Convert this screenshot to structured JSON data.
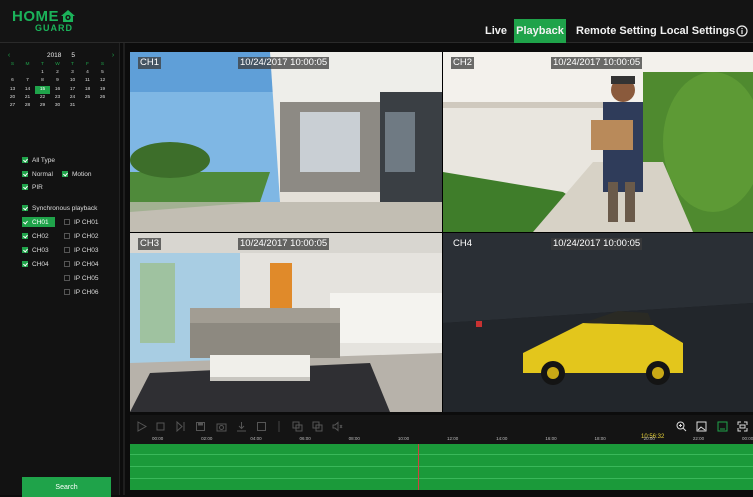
{
  "brand": {
    "line1": "HOME",
    "line2": "GUARD"
  },
  "nav": {
    "live": "Live",
    "playback": "Playback",
    "remote": "Remote Setting",
    "local": "Local Settings"
  },
  "calendar": {
    "year": "2018",
    "month": "5",
    "dow": [
      "S",
      "M",
      "T",
      "W",
      "T",
      "F",
      "S"
    ],
    "weeks": [
      [
        "",
        "",
        "1",
        "2",
        "3",
        "4",
        "5"
      ],
      [
        "6",
        "7",
        "8",
        "9",
        "10",
        "11",
        "12"
      ],
      [
        "13",
        "14",
        "15",
        "16",
        "17",
        "18",
        "19"
      ],
      [
        "20",
        "21",
        "22",
        "23",
        "24",
        "25",
        "26"
      ],
      [
        "27",
        "28",
        "29",
        "30",
        "31",
        "",
        ""
      ]
    ],
    "selected_day": "15"
  },
  "filters": {
    "all_type": "All Type",
    "normal": "Normal",
    "motion": "Motion",
    "pir": "PIR"
  },
  "sync": "Synchronous playback",
  "channels": {
    "left": [
      "CH01",
      "CH02",
      "CH03",
      "CH04"
    ],
    "right": [
      "IP CH01",
      "IP CH02",
      "IP CH03",
      "IP CH04",
      "IP CH05",
      "IP CH06"
    ]
  },
  "search_label": "Search",
  "tiles": [
    {
      "ch": "CH1",
      "ts": "10/24/2017 10:00:05"
    },
    {
      "ch": "CH2",
      "ts": "10/24/2017 10:00:05"
    },
    {
      "ch": "CH3",
      "ts": "10/24/2017 10:00:05"
    },
    {
      "ch": "CH4",
      "ts": "10/24/2017 10:00:05"
    }
  ],
  "timeline": {
    "ticks": [
      "00:00",
      "02:00",
      "04:00",
      "06:00",
      "08:00",
      "10:00",
      "12:00",
      "14:00",
      "16:00",
      "18:00",
      "20:00",
      "22:00",
      "00:00"
    ],
    "cursor_time": "10:56:32",
    "accent": "#1fa34a"
  },
  "icons": [
    "play-icon",
    "stop-icon",
    "step-icon",
    "save-icon",
    "snapshot-icon",
    "download-icon",
    "clip-icon",
    "backup-icon",
    "copy-icon",
    "volume-icon",
    "zoom-in-icon",
    "fit-icon",
    "fullscreen-icon",
    "expand-icon",
    "info-icon"
  ]
}
